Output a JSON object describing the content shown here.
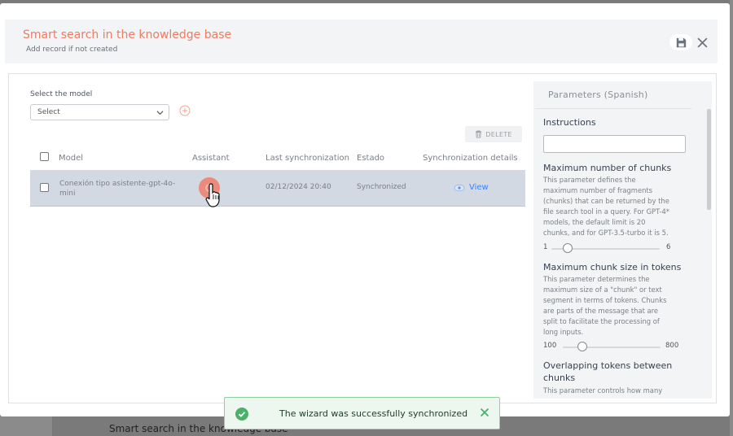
{
  "background": {
    "breadcrumb_text": "Smart search in the knowledge base"
  },
  "modal": {
    "title": "Smart search in the knowledge base",
    "subtitle": "Add record if not created",
    "save_icon": "floppy-disk-icon",
    "close_icon": "close-icon"
  },
  "model_select": {
    "label": "Select the model",
    "value": "Select",
    "add_icon": "plus-circle-icon"
  },
  "toolbar": {
    "delete_label": "DELETE"
  },
  "table": {
    "columns": [
      "Model",
      "Assistant",
      "Last synchronization",
      "Estado",
      "Synchronization details"
    ],
    "rows": [
      {
        "model": "Conexión tipo asistente-gpt-4o-mini",
        "last_sync": "02/12/2024 20:40",
        "status": "Synchronized",
        "details_label": "View"
      }
    ]
  },
  "parameters": {
    "title": "Parameters (Spanish)",
    "instructions_label": "Instructions",
    "instructions_value": "",
    "max_chunks": {
      "label": "Maximum number of chunks",
      "desc": "This parameter defines the maximum number of fragments (chunks) that can be returned by the file search tool in a query. For GPT-4* models, the default limit is 20 chunks, and for GPT-3.5-turbo it is 5.",
      "min": "1",
      "max": "6",
      "value_fraction": 0.15
    },
    "max_chunk_size": {
      "label": "Maximum chunk size in tokens",
      "desc": "This parameter determines the maximum size of a \"chunk\" or text segment in terms of tokens. Chunks are parts of the message that are split to facilitate the processing of long inputs.",
      "min": "100",
      "max": "800",
      "value_fraction": 0.2
    },
    "overlap": {
      "label": "Overlapping tokens between chunks",
      "desc": "This parameter controls how many"
    }
  },
  "toast": {
    "message": "The wizard was successfully synchronized"
  },
  "colors": {
    "accent": "#ec7c64",
    "link": "#3b82f6",
    "success": "#4caf6a"
  }
}
